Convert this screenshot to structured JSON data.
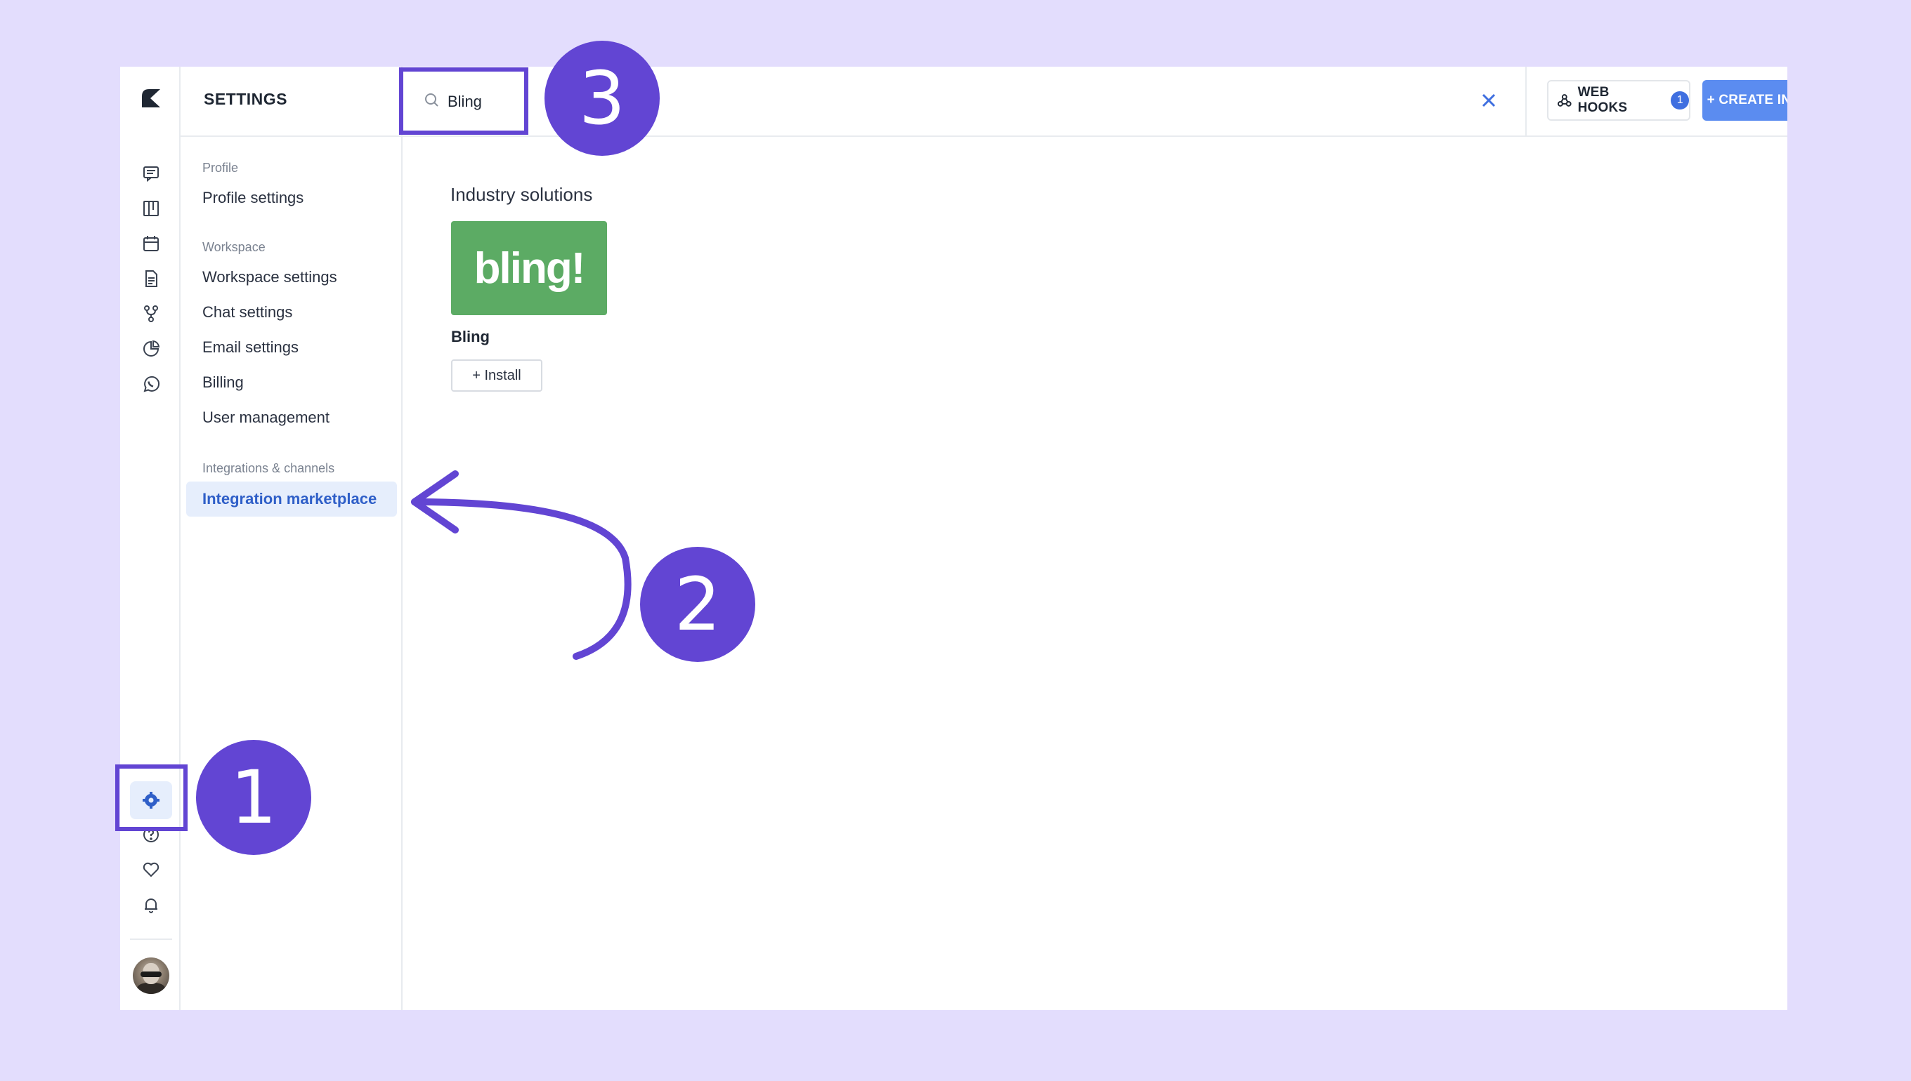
{
  "settings": {
    "title": "SETTINGS",
    "sections": [
      {
        "label": "Profile",
        "items": [
          {
            "label": "Profile settings"
          }
        ]
      },
      {
        "label": "Workspace",
        "items": [
          {
            "label": "Workspace settings"
          },
          {
            "label": "Chat settings"
          },
          {
            "label": "Email settings"
          },
          {
            "label": "Billing"
          },
          {
            "label": "User management"
          }
        ]
      },
      {
        "label": "Integrations & channels",
        "items": [
          {
            "label": "Integration marketplace",
            "active": true
          }
        ]
      }
    ]
  },
  "rail": {
    "icons": [
      "chat-icon",
      "board-icon",
      "calendar-icon",
      "document-icon",
      "flow-icon",
      "analytics-icon",
      "whatsapp-icon",
      "settings-icon",
      "help-icon",
      "heart-icon",
      "bell-icon"
    ],
    "active": "settings-icon"
  },
  "search": {
    "value": "Bling"
  },
  "header": {
    "webhooks_label": "WEB HOOKS",
    "webhooks_count": "1",
    "create_label": "+ CREATE INTEGRATION"
  },
  "main": {
    "section_title": "Industry solutions",
    "integrations": [
      {
        "logo_text": "bling!",
        "name": "Bling",
        "install_label": "+ Install"
      }
    ]
  },
  "annotations": [
    "1",
    "2",
    "3"
  ],
  "colors": {
    "background": "#e3ddfd",
    "accent": "#6245d3",
    "primary_button": "#5b8cf0",
    "bling_green": "#5cab64",
    "active_nav": "#2f5fc8"
  }
}
